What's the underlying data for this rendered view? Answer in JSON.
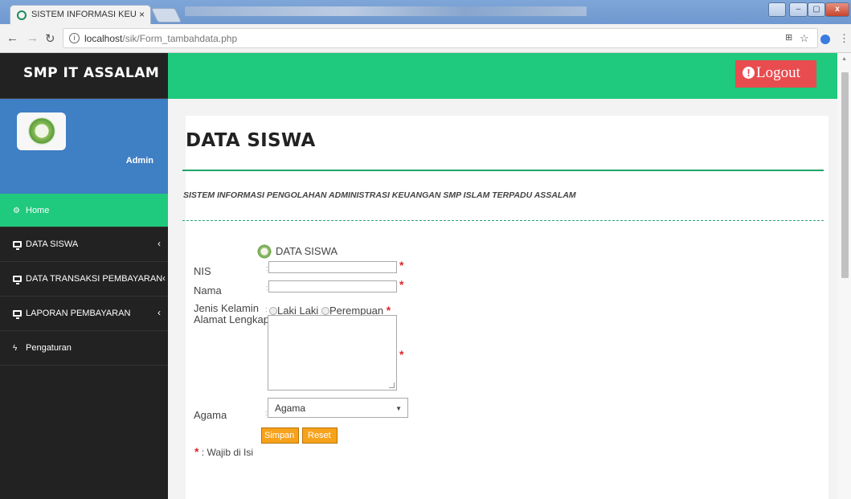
{
  "browser": {
    "tab_title": "SISTEM INFORMASI KEU",
    "tab_close": "×",
    "url_host": "localhost",
    "url_path": "/sik/Form_tambahdata.php",
    "win_min": "–",
    "win_max": "▢",
    "win_close": "x"
  },
  "sidebar": {
    "brand": "SMP IT ASSALAM",
    "user": "Admin",
    "items": [
      {
        "label": "Home",
        "icon": "dashboard-icon",
        "active": true
      },
      {
        "label": "DATA SISWA",
        "icon": "monitor-icon",
        "chevron": "‹"
      },
      {
        "label": "DATA TRANSAKSI PEMBAYARAN",
        "icon": "monitor-icon",
        "chevron": "‹"
      },
      {
        "label": "LAPORAN PEMBAYARAN",
        "icon": "monitor-icon",
        "chevron": "‹"
      },
      {
        "label": "Pengaturan",
        "icon": "bolt-icon"
      }
    ]
  },
  "header": {
    "logout_label": "Logout",
    "logout_icon": "!"
  },
  "main": {
    "title": "DATA SISWA",
    "subtitle": "SISTEM INFORMASI PENGOLAHAN ADMINISTRASI KEUANGAN SMP ISLAM TERPADU ASSALAM"
  },
  "form": {
    "title": "DATA SISWA",
    "colon": ":",
    "required_mark": "*",
    "nis_label": "NIS",
    "nama_label": "Nama",
    "jk_label": "Jenis Kelamin",
    "jk_options": [
      "Laki Laki",
      "Perempuan"
    ],
    "alamat_label": "Alamat Lengkap",
    "agama_label": "Agama",
    "agama_selected": "Agama",
    "save_label": "Simpan",
    "reset_label": "Reset",
    "required_note": ": Wajib di Isi"
  },
  "colors": {
    "green": "#1fc97d",
    "sidebar": "#222222",
    "profile": "#3f7fc4",
    "logout": "#e84c4f",
    "button": "#f7a21b"
  }
}
